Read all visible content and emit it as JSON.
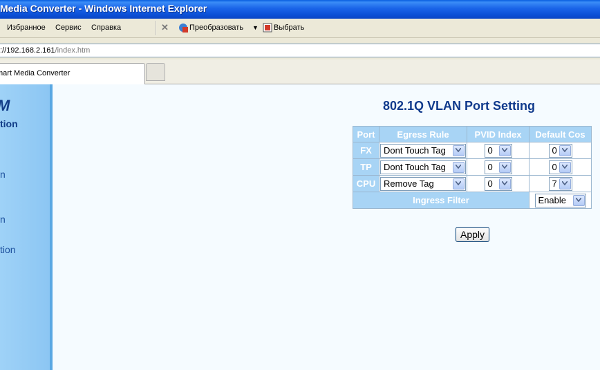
{
  "window": {
    "title": "Media Converter - Windows Internet Explorer"
  },
  "menu": {
    "favorites": "Избранное",
    "tools": "Сервис",
    "help": "Справка",
    "convert": "Преобразовать",
    "select": "Выбрать"
  },
  "address": {
    "host": "://192.168.2.161",
    "path": "/index.htm"
  },
  "tabs": {
    "active_label": "mart Media Converter"
  },
  "sidebar": {
    "brand": "M",
    "items": [
      "tion",
      "n",
      "n",
      "tion"
    ]
  },
  "page": {
    "heading": "802.1Q VLAN Port Setting"
  },
  "table": {
    "headers": [
      "Port",
      "Egress Rule",
      "PVID Index",
      "Default Cos"
    ],
    "rows": [
      {
        "port": "FX",
        "egress": "Dont Touch Tag",
        "pvid": "0",
        "cos": "0"
      },
      {
        "port": "TP",
        "egress": "Dont Touch Tag",
        "pvid": "0",
        "cos": "0"
      },
      {
        "port": "CPU",
        "egress": "Remove Tag",
        "pvid": "0",
        "cos": "7"
      }
    ],
    "ingress_label": "Ingress Filter",
    "ingress_value": "Enable"
  },
  "buttons": {
    "apply": "Apply"
  },
  "colors": {
    "heading": "#103a8c",
    "header_cell": "#a8d4f5",
    "title_bar": "#0b4fd6"
  }
}
